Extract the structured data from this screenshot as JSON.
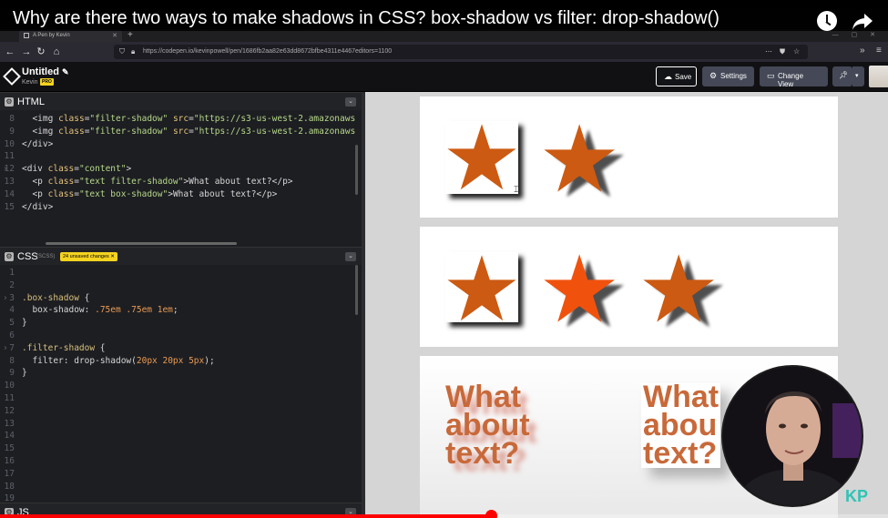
{
  "video": {
    "title": "Why are there two ways to make shadows in CSS? box-shadow vs filter: drop-shadow()",
    "progress_fraction": 0.553,
    "watermark": "KP"
  },
  "browser": {
    "tab_title": "A Pen by Kevin",
    "url": "https://codepen.io/kevinpowell/pen/1686fb2aa82e63dd8672bfbe4311e4467editors=1100"
  },
  "pen": {
    "title": "Untitled",
    "author": "Kevin",
    "badge": "PRO",
    "buttons": {
      "save": "Save",
      "settings": "Settings",
      "change_view": "Change View"
    }
  },
  "html_editor": {
    "name": "HTML",
    "lines": [
      {
        "n": "8",
        "html": "  <span class='tag'>&lt;img</span> <span class='attr'>class</span>=<span class='str'>\"filter-shadow\"</span> <span class='attr'>src</span>=<span class='str'>\"https://s3-us-west-2.amazonaws.com</span>"
      },
      {
        "n": "9",
        "html": "  <span class='tag'>&lt;img</span> <span class='attr'>class</span>=<span class='str'>\"filter-shadow\"</span> <span class='attr'>src</span>=<span class='str'>\"https://s3-us-west-2.amazonaws.com</span>"
      },
      {
        "n": "10",
        "html": "<span class='tag'>&lt;/div&gt;</span>"
      },
      {
        "n": "11",
        "html": ""
      },
      {
        "n": "12",
        "html": "<span class='tag'>&lt;div</span> <span class='attr'>class</span>=<span class='str'>\"content\"</span><span class='tag'>&gt;</span>",
        "arrow": true
      },
      {
        "n": "13",
        "html": "  <span class='tag'>&lt;p</span> <span class='attr'>class</span>=<span class='str'>\"text filter-shadow\"</span><span class='tag'>&gt;</span>What about text?<span class='tag'>&lt;/p&gt;</span>"
      },
      {
        "n": "14",
        "html": "  <span class='tag'>&lt;p</span> <span class='attr'>class</span>=<span class='str'>\"text box-shadow\"</span><span class='tag'>&gt;</span>What about text?<span class='tag'>&lt;/p&gt;</span>"
      },
      {
        "n": "15",
        "html": "<span class='tag'>&lt;/div&gt;</span>"
      }
    ]
  },
  "css_editor": {
    "name": "CSS",
    "preprocessor": "(SCSS)",
    "unsaved": "24 unsaved changes ✕",
    "lines": [
      {
        "n": "1",
        "html": ""
      },
      {
        "n": "2",
        "html": ""
      },
      {
        "n": "3",
        "html": "<span class='sel'>.box-shadow</span> {",
        "arrow": true
      },
      {
        "n": "4",
        "html": "  <span class='prop'>box-shadow</span>: <span class='num'>.75em .75em 1em</span>;"
      },
      {
        "n": "5",
        "html": "}"
      },
      {
        "n": "6",
        "html": ""
      },
      {
        "n": "7",
        "html": "<span class='sel'>.filter-shadow</span> {",
        "arrow": true
      },
      {
        "n": "8",
        "html": "  <span class='prop'>filter</span>: <span class='fn'>drop-shadow(</span><span class='num'>20px 20px 5px</span>);"
      },
      {
        "n": "9",
        "html": "}"
      },
      {
        "n": "10",
        "html": ""
      },
      {
        "n": "11",
        "html": ""
      },
      {
        "n": "12",
        "html": ""
      },
      {
        "n": "13",
        "html": ""
      },
      {
        "n": "14",
        "html": ""
      },
      {
        "n": "15",
        "html": ""
      },
      {
        "n": "16",
        "html": ""
      },
      {
        "n": "17",
        "html": ""
      },
      {
        "n": "18",
        "html": ""
      },
      {
        "n": "19",
        "html": ""
      }
    ]
  },
  "js_editor": {
    "name": "JS"
  },
  "preview": {
    "text_sample_1": [
      "What",
      "about",
      "text?"
    ],
    "text_sample_2": [
      "What",
      "abou",
      "text?"
    ]
  },
  "colors": {
    "star": "#cc5a12",
    "star_bright": "#f0520e",
    "progress": "#ff0000"
  }
}
